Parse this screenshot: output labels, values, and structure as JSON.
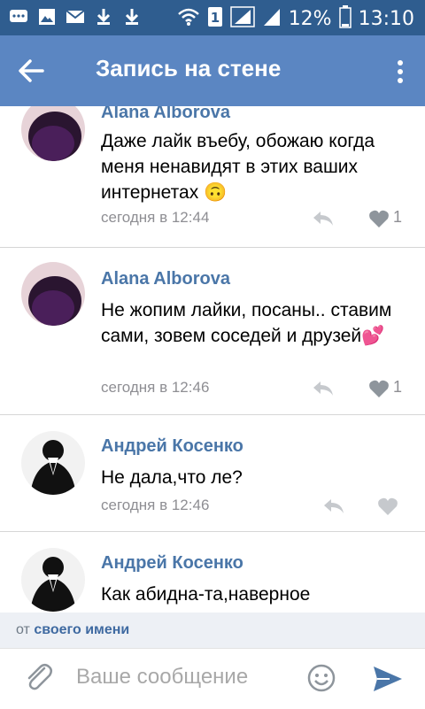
{
  "status_bar": {
    "battery": "12%",
    "time": "13:10"
  },
  "header": {
    "title": "Запись на стене"
  },
  "comments": [
    {
      "author": "Alana Alborova",
      "text": "Даже лайк въебу, обожаю когда меня ненавидят в этих ваших интернетах 🙃",
      "time": "сегодня в 12:44",
      "likes": "1"
    },
    {
      "author": "Alana Alborova",
      "text": "Не жопим лайки, посаны.. ставим сами, зовем соседей и друзей💕",
      "time": "сегодня в 12:46",
      "likes": "1"
    },
    {
      "author": "Андрей Косенко",
      "text": "Не дала,что ле?",
      "time": "сегодня в 12:46",
      "likes": ""
    },
    {
      "author": "Андрей Косенко",
      "text": "Как абидна-та,наверное",
      "time": "",
      "likes": ""
    }
  ],
  "from_bar": {
    "prefix": "от",
    "link": "своего имени"
  },
  "composer": {
    "placeholder": "Ваше сообщение"
  },
  "colors": {
    "accent": "#5b86c2",
    "status_bar": "#2f5d8f",
    "link": "#4a76a8"
  }
}
